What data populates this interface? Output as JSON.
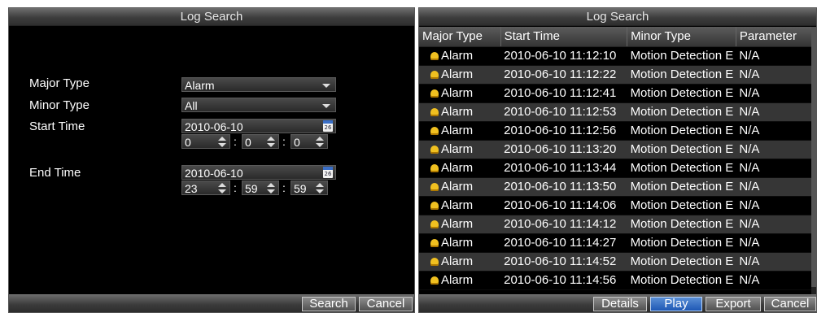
{
  "search_panel": {
    "title": "Log Search",
    "major_type_label": "Major Type",
    "major_type_value": "Alarm",
    "minor_type_label": "Minor Type",
    "minor_type_value": "All",
    "start_time_label": "Start Time",
    "start_date": "2010-06-10",
    "start_hour": "0",
    "start_minute": "0",
    "start_second": "0",
    "end_time_label": "End Time",
    "end_date": "2010-06-10",
    "end_hour": "23",
    "end_minute": "59",
    "end_second": "59",
    "calendar_day": "26",
    "time_separator": ":",
    "search_button": "Search",
    "cancel_button": "Cancel"
  },
  "results_panel": {
    "title": "Log Search",
    "columns": [
      "Major Type",
      "Start Time",
      "Minor Type",
      "Parameter"
    ],
    "rows": [
      {
        "major": "Alarm",
        "time": "2010-06-10 11:12:10",
        "minor": "Motion Detection E",
        "param": "N/A"
      },
      {
        "major": "Alarm",
        "time": "2010-06-10 11:12:22",
        "minor": "Motion Detection E",
        "param": "N/A"
      },
      {
        "major": "Alarm",
        "time": "2010-06-10 11:12:41",
        "minor": "Motion Detection E",
        "param": "N/A"
      },
      {
        "major": "Alarm",
        "time": "2010-06-10 11:12:53",
        "minor": "Motion Detection E",
        "param": "N/A"
      },
      {
        "major": "Alarm",
        "time": "2010-06-10 11:12:56",
        "minor": "Motion Detection E",
        "param": "N/A"
      },
      {
        "major": "Alarm",
        "time": "2010-06-10 11:13:20",
        "minor": "Motion Detection E",
        "param": "N/A"
      },
      {
        "major": "Alarm",
        "time": "2010-06-10 11:13:44",
        "minor": "Motion Detection E",
        "param": "N/A"
      },
      {
        "major": "Alarm",
        "time": "2010-06-10 11:13:50",
        "minor": "Motion Detection E",
        "param": "N/A"
      },
      {
        "major": "Alarm",
        "time": "2010-06-10 11:14:06",
        "minor": "Motion Detection E",
        "param": "N/A"
      },
      {
        "major": "Alarm",
        "time": "2010-06-10 11:14:12",
        "minor": "Motion Detection E",
        "param": "N/A"
      },
      {
        "major": "Alarm",
        "time": "2010-06-10 11:14:27",
        "minor": "Motion Detection E",
        "param": "N/A"
      },
      {
        "major": "Alarm",
        "time": "2010-06-10 11:14:52",
        "minor": "Motion Detection E",
        "param": "N/A"
      },
      {
        "major": "Alarm",
        "time": "2010-06-10 11:14:56",
        "minor": "Motion Detection E",
        "param": "N/A"
      }
    ],
    "details_button": "Details",
    "play_button": "Play",
    "export_button": "Export",
    "cancel_button": "Cancel"
  },
  "icons": {
    "row_icon": "alarm-bell-icon",
    "date_picker_icon": "calendar-icon"
  },
  "colors": {
    "panel_background": "#000000",
    "alternate_row": "#363636",
    "primary_button": "#1e58b4",
    "alarm_icon": "#f0c020"
  }
}
